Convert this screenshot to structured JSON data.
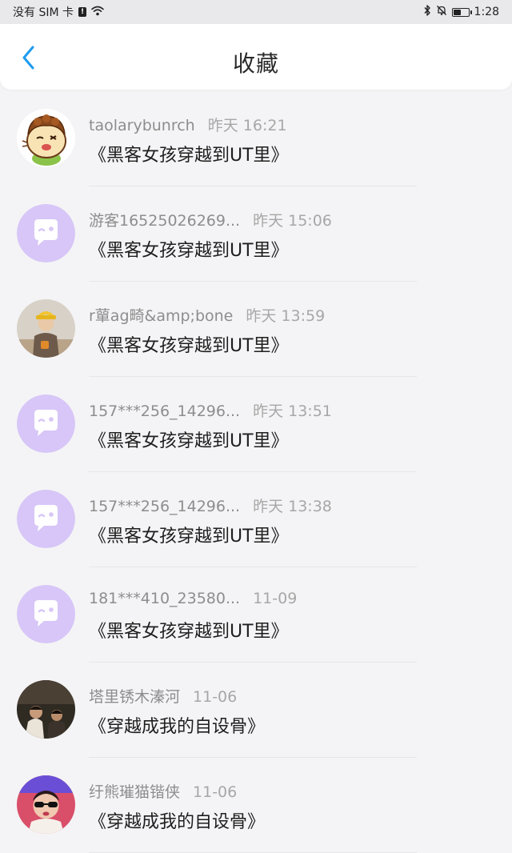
{
  "status_bar": {
    "carrier": "没有 SIM 卡",
    "sim_badge": "!",
    "time": "1:28",
    "battery_level": 0.55
  },
  "header": {
    "back_icon": "chevron-left-icon",
    "title": "收藏",
    "accent_color": "#1e9bf0"
  },
  "avatar_placeholder_color": "#d7c6f7",
  "items": [
    {
      "user": "taolarybunrch",
      "time": "昨天 16:21",
      "book": "《黑客女孩穿越到UT里》",
      "avatar": "cartoon-avatar"
    },
    {
      "user": "游客16525026269...",
      "time": "昨天 15:06",
      "book": "《黑客女孩穿越到UT里》",
      "avatar": "chat-bubble-avatar"
    },
    {
      "user": "r蕇ag畸&amp;bone",
      "time": "昨天 13:59",
      "book": "《黑客女孩穿越到UT里》",
      "avatar": "photo-avatar"
    },
    {
      "user": "157***256_14296...",
      "time": "昨天 13:51",
      "book": "《黑客女孩穿越到UT里》",
      "avatar": "chat-bubble-avatar"
    },
    {
      "user": "157***256_14296...",
      "time": "昨天 13:38",
      "book": "《黑客女孩穿越到UT里》",
      "avatar": "chat-bubble-avatar"
    },
    {
      "user": "181***410_23580...",
      "time": "11-09",
      "book": "《黑客女孩穿越到UT里》",
      "avatar": "chat-bubble-avatar"
    },
    {
      "user": "塔里锈木溱河",
      "time": "11-06",
      "book": "《穿越成我的自设骨》",
      "avatar": "photo-avatar-dark"
    },
    {
      "user": "纡熊璀猫锴侠",
      "time": "11-06",
      "book": "《穿越成我的自设骨》",
      "avatar": "photo-avatar-sunglasses"
    }
  ]
}
